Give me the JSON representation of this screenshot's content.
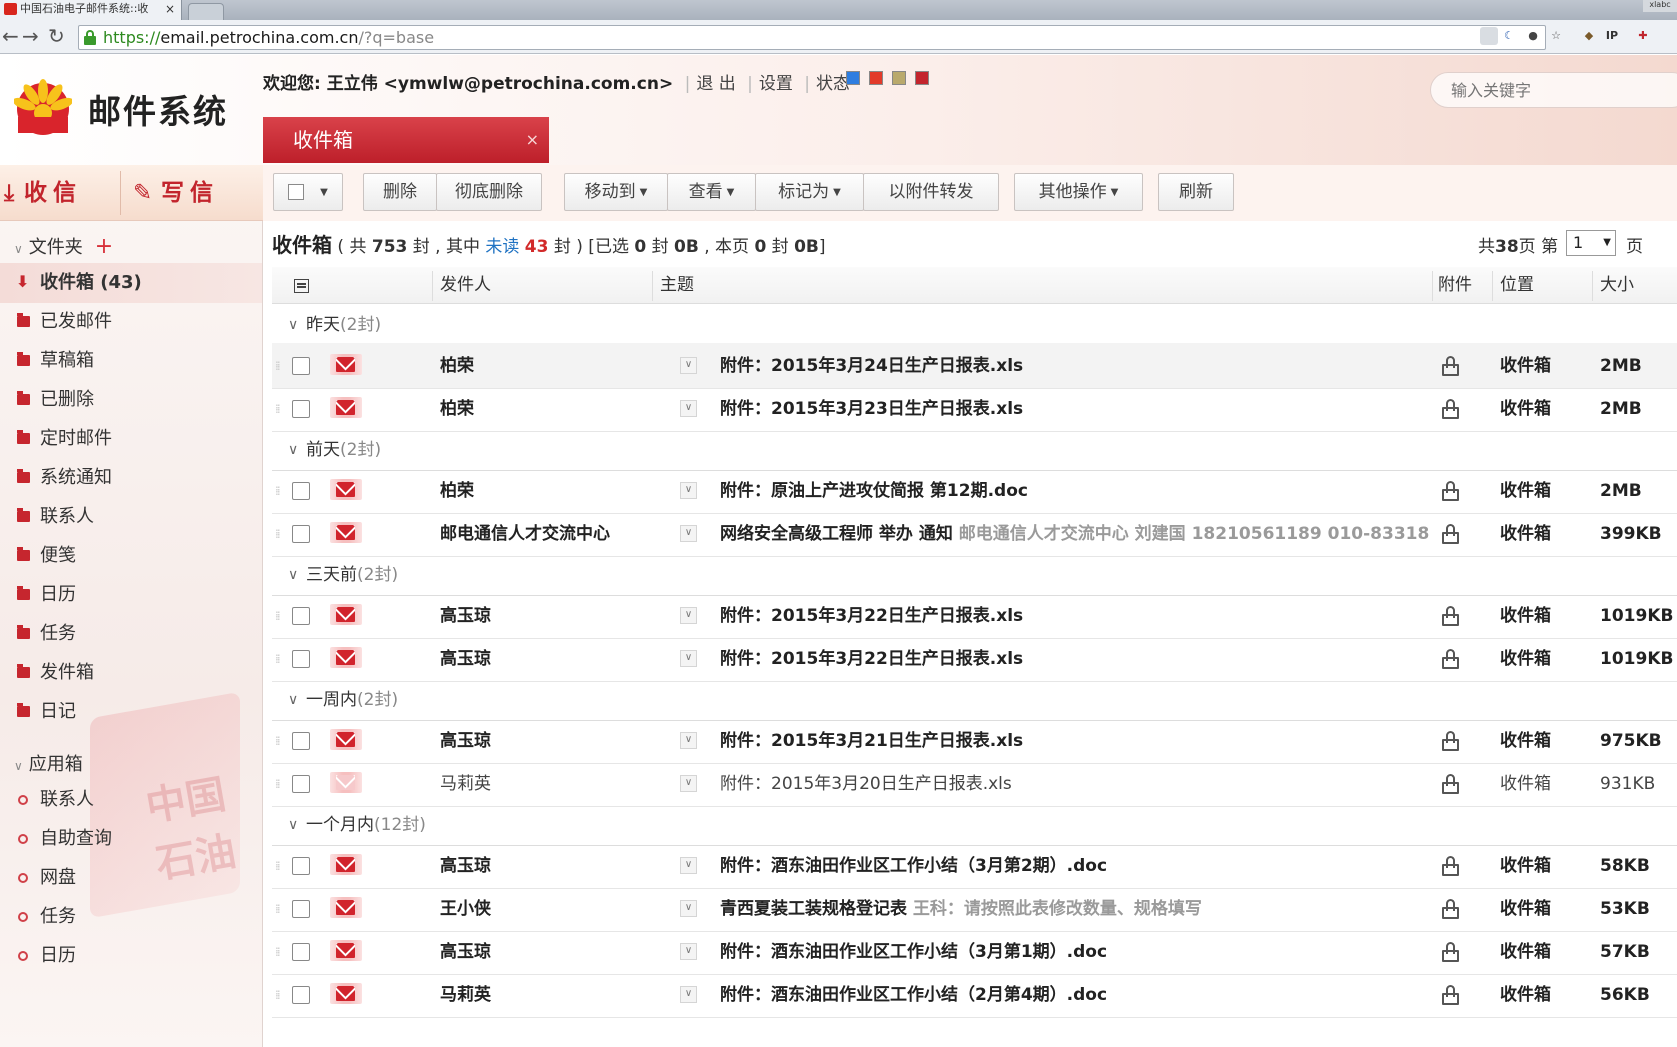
{
  "browser": {
    "tab_title": "中国石油电子邮件系统::收",
    "tab_close": "×",
    "url_https": "https://",
    "url_host": "email.petrochina.com.cn",
    "url_rest": "/?q=base",
    "nav_back": "←",
    "nav_forward": "→",
    "nav_reload": "↻",
    "window_label": "xlabc"
  },
  "header": {
    "logo_text": "邮件系统",
    "welcome_prefix": "欢迎您: 王立伟 <ymwlw@petrochina.com.cn>",
    "links": [
      "退 出",
      "设置",
      "状态"
    ],
    "skin_colors": [
      "#2e7de0",
      "#e23a2a",
      "#b9a96c",
      "#c3242d"
    ],
    "search_placeholder": "输入关键字",
    "active_tab": "收件箱",
    "active_tab_close": "×"
  },
  "sidebar": {
    "receive": "收信",
    "compose": "写信",
    "folders_title": "文件夹",
    "folders_add": "+",
    "folders": [
      {
        "label": "收件箱 (43)",
        "active": true
      },
      {
        "label": "已发邮件"
      },
      {
        "label": "草稿箱"
      },
      {
        "label": "已删除"
      },
      {
        "label": "定时邮件"
      },
      {
        "label": "系统通知"
      },
      {
        "label": "联系人"
      },
      {
        "label": "便笺"
      },
      {
        "label": "日历"
      },
      {
        "label": "任务"
      },
      {
        "label": "发件箱"
      },
      {
        "label": "日记"
      }
    ],
    "apps_title": "应用箱",
    "apps": [
      "联系人",
      "自助查询",
      "网盘",
      "任务",
      "日历"
    ]
  },
  "toolbar": {
    "delete": "删除",
    "delete_permanent": "彻底删除",
    "move_to": "移动到",
    "view": "查看",
    "mark_as": "标记为",
    "forward_as_attachment": "以附件转发",
    "more": "其他操作",
    "refresh": "刷新"
  },
  "summary": {
    "folder": "收件箱",
    "total_pre": "( 共 ",
    "total": "753",
    "mid1": " 封 , 其中 ",
    "unread_label": "未读",
    "unread": "43",
    "mid2": " 封 ) [已选 ",
    "selected": "0",
    "mid3": " 封 ",
    "selected_size": "0B",
    "mid4": " , 本页 ",
    "page_count": "0",
    "mid5": " 封 ",
    "page_size": "0B",
    "end": "]"
  },
  "pager": {
    "prefix": "共",
    "pages": "38",
    "mid": "页 第",
    "current": "1",
    "suffix": "页"
  },
  "columns": {
    "sender": "发件人",
    "subject": "主题",
    "attachment": "附件",
    "location": "位置",
    "size": "大小"
  },
  "groups": [
    {
      "name": "昨天",
      "count": "(2封)"
    },
    {
      "name": "前天",
      "count": "(2封)"
    },
    {
      "name": "三天前",
      "count": "(2封)"
    },
    {
      "name": "一周内",
      "count": "(2封)"
    },
    {
      "name": "一个月内",
      "count": "(12封)"
    }
  ],
  "emails": [
    {
      "sender": "柏荣",
      "subject": "附件：2015年3月24日生产日报表.xls",
      "preview": "",
      "location": "收件箱",
      "size": "2MB",
      "unread": true
    },
    {
      "sender": "柏荣",
      "subject": "附件：2015年3月23日生产日报表.xls",
      "preview": "",
      "location": "收件箱",
      "size": "2MB",
      "unread": true
    },
    {
      "sender": "柏荣",
      "subject": "附件：原油上产进攻仗简报 第12期.doc",
      "preview": "",
      "location": "收件箱",
      "size": "2MB",
      "unread": true
    },
    {
      "sender": "邮电通信人才交流中心",
      "subject": "网络安全高级工程师 举办 通知 ",
      "preview": "邮电通信人才交流中心 刘建国 18210561189 010-83318",
      "location": "收件箱",
      "size": "399KB",
      "unread": true
    },
    {
      "sender": "高玉琼",
      "subject": "附件：2015年3月22日生产日报表.xls",
      "preview": "",
      "location": "收件箱",
      "size": "1019KB",
      "unread": true
    },
    {
      "sender": "高玉琼",
      "subject": "附件：2015年3月22日生产日报表.xls",
      "preview": "",
      "location": "收件箱",
      "size": "1019KB",
      "unread": true
    },
    {
      "sender": "高玉琼",
      "subject": "附件：2015年3月21日生产日报表.xls",
      "preview": "",
      "location": "收件箱",
      "size": "975KB",
      "unread": true
    },
    {
      "sender": "马莉英",
      "subject": "附件：2015年3月20日生产日报表.xls",
      "preview": "",
      "location": "收件箱",
      "size": "931KB",
      "unread": false
    },
    {
      "sender": "高玉琼",
      "subject": "附件：酒东油田作业区工作小结（3月第2期）.doc",
      "preview": "",
      "location": "收件箱",
      "size": "58KB",
      "unread": true
    },
    {
      "sender": "王小侠",
      "subject": "青西夏装工装规格登记表 ",
      "preview": "王科：请按照此表修改数量、规格填写",
      "location": "收件箱",
      "size": "53KB",
      "unread": true
    },
    {
      "sender": "高玉琼",
      "subject": "附件：酒东油田作业区工作小结（3月第1期）.doc",
      "preview": "",
      "location": "收件箱",
      "size": "57KB",
      "unread": true
    },
    {
      "sender": "马莉英",
      "subject": "附件：酒东油田作业区工作小结（2月第4期）.doc",
      "preview": "",
      "location": "收件箱",
      "size": "56KB",
      "unread": true
    }
  ],
  "watermark_text": "中国石油"
}
